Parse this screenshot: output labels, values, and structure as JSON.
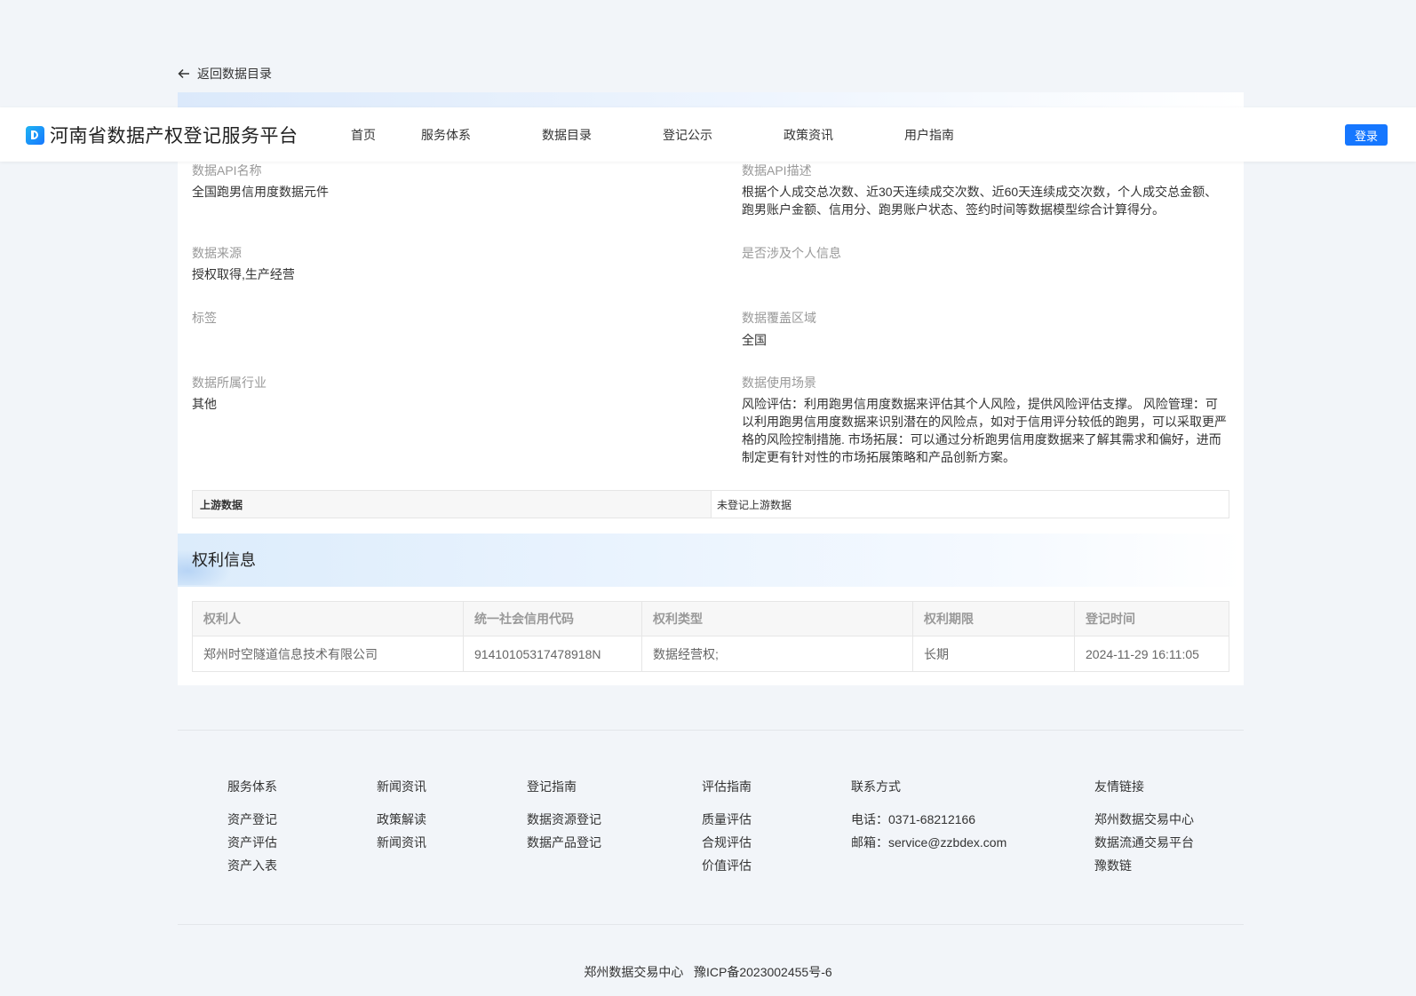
{
  "back_link": {
    "label": "返回数据目录",
    "icon": "arrow-left-icon"
  },
  "header": {
    "logo_text": "河南省数据产权登记服务平台",
    "nav": [
      "首页",
      "服务体系",
      "数据目录",
      "登记公示",
      "政策资讯",
      "用户指南"
    ],
    "login_label": "登录",
    "accent_color": "#1677ff"
  },
  "fields": {
    "api_name": {
      "label": "数据API名称",
      "value": "全国跑男信用度数据元件"
    },
    "api_desc": {
      "label": "数据API描述",
      "value": "根据个人成交总次数、近30天连续成交次数、近60天连续成交次数，个人成交总金额、跑男账户金额、信用分、跑男账户状态、签约时间等数据模型综合计算得分。"
    },
    "source": {
      "label": "数据来源",
      "value": "授权取得,生产经营"
    },
    "personal_info": {
      "label": "是否涉及个人信息",
      "value": ""
    },
    "tags": {
      "label": "标签",
      "value": ""
    },
    "coverage": {
      "label": "数据覆盖区域",
      "value": "全国"
    },
    "industry": {
      "label": "数据所属行业",
      "value": "其他"
    },
    "scenario": {
      "label": "数据使用场景",
      "value": "风险评估：利用跑男信用度数据来评估其个人风险，提供风险评估支撑。 风险管理：可以利用跑男信用度数据来识别潜在的风险点，如对于信用评分较低的跑男，可以采取更严格的风险控制措施. 市场拓展：可以通过分析跑男信用度数据来了解其需求和偏好，进而制定更有针对性的市场拓展策略和产品创新方案。"
    }
  },
  "upstream": {
    "label": "上游数据",
    "value": "未登记上游数据"
  },
  "rights": {
    "title": "权利信息",
    "columns": [
      "权利人",
      "统一社会信用代码",
      "权利类型",
      "权利期限",
      "登记时间"
    ],
    "rows": [
      [
        "郑州时空隧道信息技术有限公司",
        "91410105317478918N",
        "数据经营权;",
        "长期",
        "2024-11-29 16:11:05"
      ]
    ]
  },
  "footer": {
    "columns": [
      {
        "title": "服务体系",
        "items": [
          "资产登记",
          "资产评估",
          "资产入表"
        ]
      },
      {
        "title": "新闻资讯",
        "items": [
          "政策解读",
          "新闻资讯"
        ]
      },
      {
        "title": "登记指南",
        "items": [
          "数据资源登记",
          "数据产品登记"
        ]
      },
      {
        "title": "评估指南",
        "items": [
          "质量评估",
          "合规评估",
          "价值评估"
        ]
      },
      {
        "title": "联系方式",
        "items": [
          "电话：0371-68212166",
          "邮箱：service@zzbdex.com"
        ]
      },
      {
        "title": "友情链接",
        "items": [
          "郑州数据交易中心",
          "数据流通交易平台",
          "豫数链"
        ]
      }
    ],
    "copyright": "郑州数据交易中心   豫ICP备2023002455号-6"
  }
}
